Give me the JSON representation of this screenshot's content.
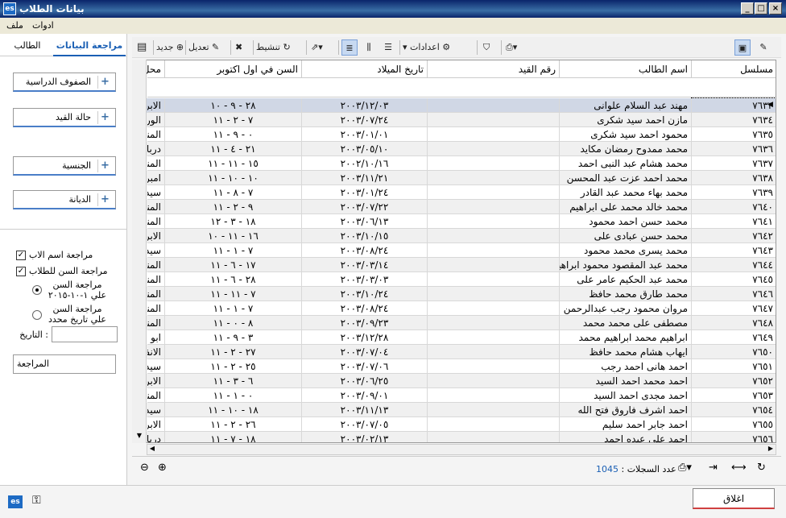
{
  "window": {
    "title": "بيانات الطلاب",
    "app_icon": "es"
  },
  "menu": {
    "items": [
      "ملف",
      "ادوات"
    ]
  },
  "left": {
    "tabs": [
      "مراجعة البيانات",
      "الطالب"
    ],
    "filters": [
      "الصفوف الدراسية",
      "حالة القيد",
      "الجنسية",
      "الديانة"
    ],
    "opt_father": "مراجعة اسم الاب",
    "opt_age": "مراجعة السن للطلاب",
    "radio_oct_1": "مراجعة السن",
    "radio_oct_2": "علي ١-١٠-٢٠١٥",
    "radio_date_1": "مراجعة السن",
    "radio_date_2": "علي تاريخ محدد",
    "date_label": ": التاريخ",
    "review_label": "المراجعة"
  },
  "toolbar": {
    "new": "جديد",
    "edit": "تعديل",
    "refresh": "تنشيط",
    "settings": "اعدادات"
  },
  "grid": {
    "columns": [
      "مسلسل",
      "اسم الطالب",
      "رقم القيد",
      "تاريخ الميلاد",
      "السن في اول اكتوبر",
      "محل"
    ],
    "rows": [
      [
        "٧٦٣٣",
        "مهند عبد السلام علوانى",
        "",
        "٢٠٠٣/١٢/٠٣",
        "٢٨ - ٩ - ١٠",
        "الابرا"
      ],
      [
        "٧٦٣٤",
        "مازن احمد سيد شكرى",
        "",
        "٢٠٠٣/٠٧/٢٤",
        "٧ - ٢ - ١١",
        "الوري"
      ],
      [
        "٧٦٣٥",
        "محمود احمد سيد شكرى",
        "",
        "٢٠٠٣/٠١/٠١",
        "٠ - ٩ - ١١",
        "المندر"
      ],
      [
        "٧٦٣٦",
        "محمد ممدوح رمضان مكايد",
        "",
        "٢٠٠٣/٠٥/١٠",
        "٢١ - ٤ - ١١",
        "دربالا"
      ],
      [
        "٧٦٣٧",
        "محمد هشام عبد النبى احمد",
        "",
        "٢٠٠٢/١٠/١٦",
        "١٥ - ١١ - ١١",
        "المندر"
      ],
      [
        "٧٦٣٨",
        "محمد احمد عزت عبد المحسن",
        "",
        "٢٠٠٣/١١/٢١",
        "١٠ - ١٠ - ١١",
        "امبرو"
      ],
      [
        "٧٦٣٩",
        "محمد بهاء محمد عبد القادر",
        "",
        "٢٠٠٣/٠١/٢٤",
        "٧ - ٨ - ١١",
        "سيدي"
      ],
      [
        "٧٦٤٠",
        "محمد خالد محمد على ابراهيم",
        "",
        "٢٠٠٣/٠٧/٢٢",
        "٩ - ٢ - ١١",
        "المندر"
      ],
      [
        "٧٦٤١",
        "محمد حسن احمد محمود",
        "",
        "٢٠٠٣/٠٦/١٣",
        "١٨ - ٣ - ١٢",
        "المندر"
      ],
      [
        "٧٦٤٢",
        "محمد حسن عبادى على",
        "",
        "٢٠٠٣/١٠/١٥",
        "١٦ - ١١ - ١٠",
        "الابرا"
      ],
      [
        "٧٦٤٣",
        "محمد يسرى محمد محمود",
        "",
        "٢٠٠٣/٠٨/٢٤",
        "٧ - ١ - ١١",
        "سيدي"
      ],
      [
        "٧٦٤٤",
        "محمد عبد المقصود محمود ابراهيم",
        "",
        "٢٠٠٣/٠٣/١٤",
        "١٧ - ٦ - ١١",
        "المندر"
      ],
      [
        "٧٦٤٥",
        "محمد عبد الحكيم عامر على",
        "",
        "٢٠٠٣/٠٣/٠٣",
        "٢٨ - ٦ - ١١",
        "المندر"
      ],
      [
        "٧٦٤٦",
        "محمد طارق محمد حافظ",
        "",
        "٢٠٠٣/١٠/٢٤",
        "٧ - ١١ - ١١",
        "المندر"
      ],
      [
        "٧٦٤٧",
        "مروان محمود رجب عبدالرحمن",
        "",
        "٢٠٠٣/٠٨/٢٤",
        "٧ - ١ - ١١",
        "المندر"
      ],
      [
        "٧٦٤٨",
        "مصطفى على محمد محمد",
        "",
        "٢٠٠٣/٠٩/٢٣",
        "٨ - ٠ - ١١",
        "المندر"
      ],
      [
        "٧٦٤٩",
        "ابراهيم محمد ابراهيم محمد",
        "",
        "٢٠٠٣/١٢/٢٨",
        "٣ - ٩ - ١١",
        "ابو قير"
      ],
      [
        "٧٦٥٠",
        "ايهاب هشام محمد حافظ",
        "",
        "٢٠٠٣/٠٧/٠٤",
        "٢٧ - ٢ - ١١",
        "الانفو"
      ],
      [
        "٧٦٥١",
        "احمد هانى احمد رجب",
        "",
        "٢٠٠٣/٠٧/٠٦",
        "٢٥ - ٢ - ١١",
        "سيدي"
      ],
      [
        "٧٦٥٢",
        "احمد محمد احمد السيد",
        "",
        "٢٠٠٣/٠٦/٢٥",
        "٦ - ٣ - ١١",
        "الابرا"
      ],
      [
        "٧٦٥٣",
        "احمد مجدى احمد السيد",
        "",
        "٢٠٠٣/٠٩/٠١",
        "٠ - ١ - ١١",
        "المندر"
      ],
      [
        "٧٦٥٤",
        "احمد اشرف فاروق فتح الله",
        "",
        "٢٠٠٣/١١/١٣",
        "١٨ - ١٠ - ١١",
        "سيدي"
      ],
      [
        "٧٦٥٥",
        "احمد جابر احمد سليم",
        "",
        "٢٠٠٣/٠٧/٠٥",
        "٢٦ - ٢ - ١١",
        "الابرا"
      ],
      [
        "٧٦٥٦",
        "احمد على عبده احمد",
        "",
        "٢٠٠٣/٠٢/١٣",
        "١٨ - ٧ - ١١",
        "دربالا"
      ]
    ]
  },
  "status": {
    "count_label": "عدد السجلات :",
    "count_value": "1045"
  },
  "bottom": {
    "close": "اغلاق"
  }
}
